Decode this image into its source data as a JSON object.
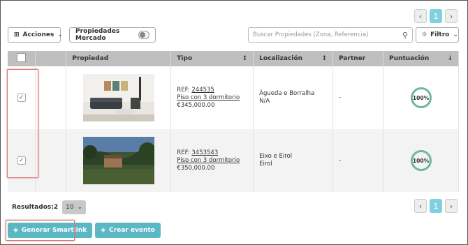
{
  "pager_top": {
    "prev": "‹",
    "page": "1",
    "next": "›"
  },
  "pager_bottom": {
    "prev": "‹",
    "page": "1",
    "next": "›"
  },
  "toolbar": {
    "actions_label": "Acciones",
    "market_label": "Propiedades Mercado",
    "search_placeholder": "Buscar Propiedades (Zona, Referencia)",
    "filter_label": "Filtro"
  },
  "table": {
    "headers": {
      "property": "Propiedad",
      "type": "Tipo",
      "location": "Localización",
      "partner": "Partner",
      "score": "Puntuación"
    },
    "rows": [
      {
        "ref_label": "REF:",
        "ref": "244535",
        "title": "Piso con 3 dormitorio",
        "price": "€345,000.00",
        "location1": "Águeda e Borralha",
        "location2": "N/A",
        "partner": "-",
        "score": "100%"
      },
      {
        "ref_label": "REF:",
        "ref": "3453543",
        "title": "Piso con 3 dormitorio",
        "price": "€350,000.00",
        "location1": "Eixo e Eirol",
        "location2": "Eirol",
        "partner": "-",
        "score": "100%"
      }
    ]
  },
  "footer": {
    "results_label": "Resultados:2",
    "page_size": "10"
  },
  "buttons": {
    "smartlink": "Generar Smartlink",
    "event": "Crear evento"
  },
  "colors": {
    "accent": "#5cb7c4",
    "score_ring": "#6db89d",
    "highlight": "#d97878"
  }
}
